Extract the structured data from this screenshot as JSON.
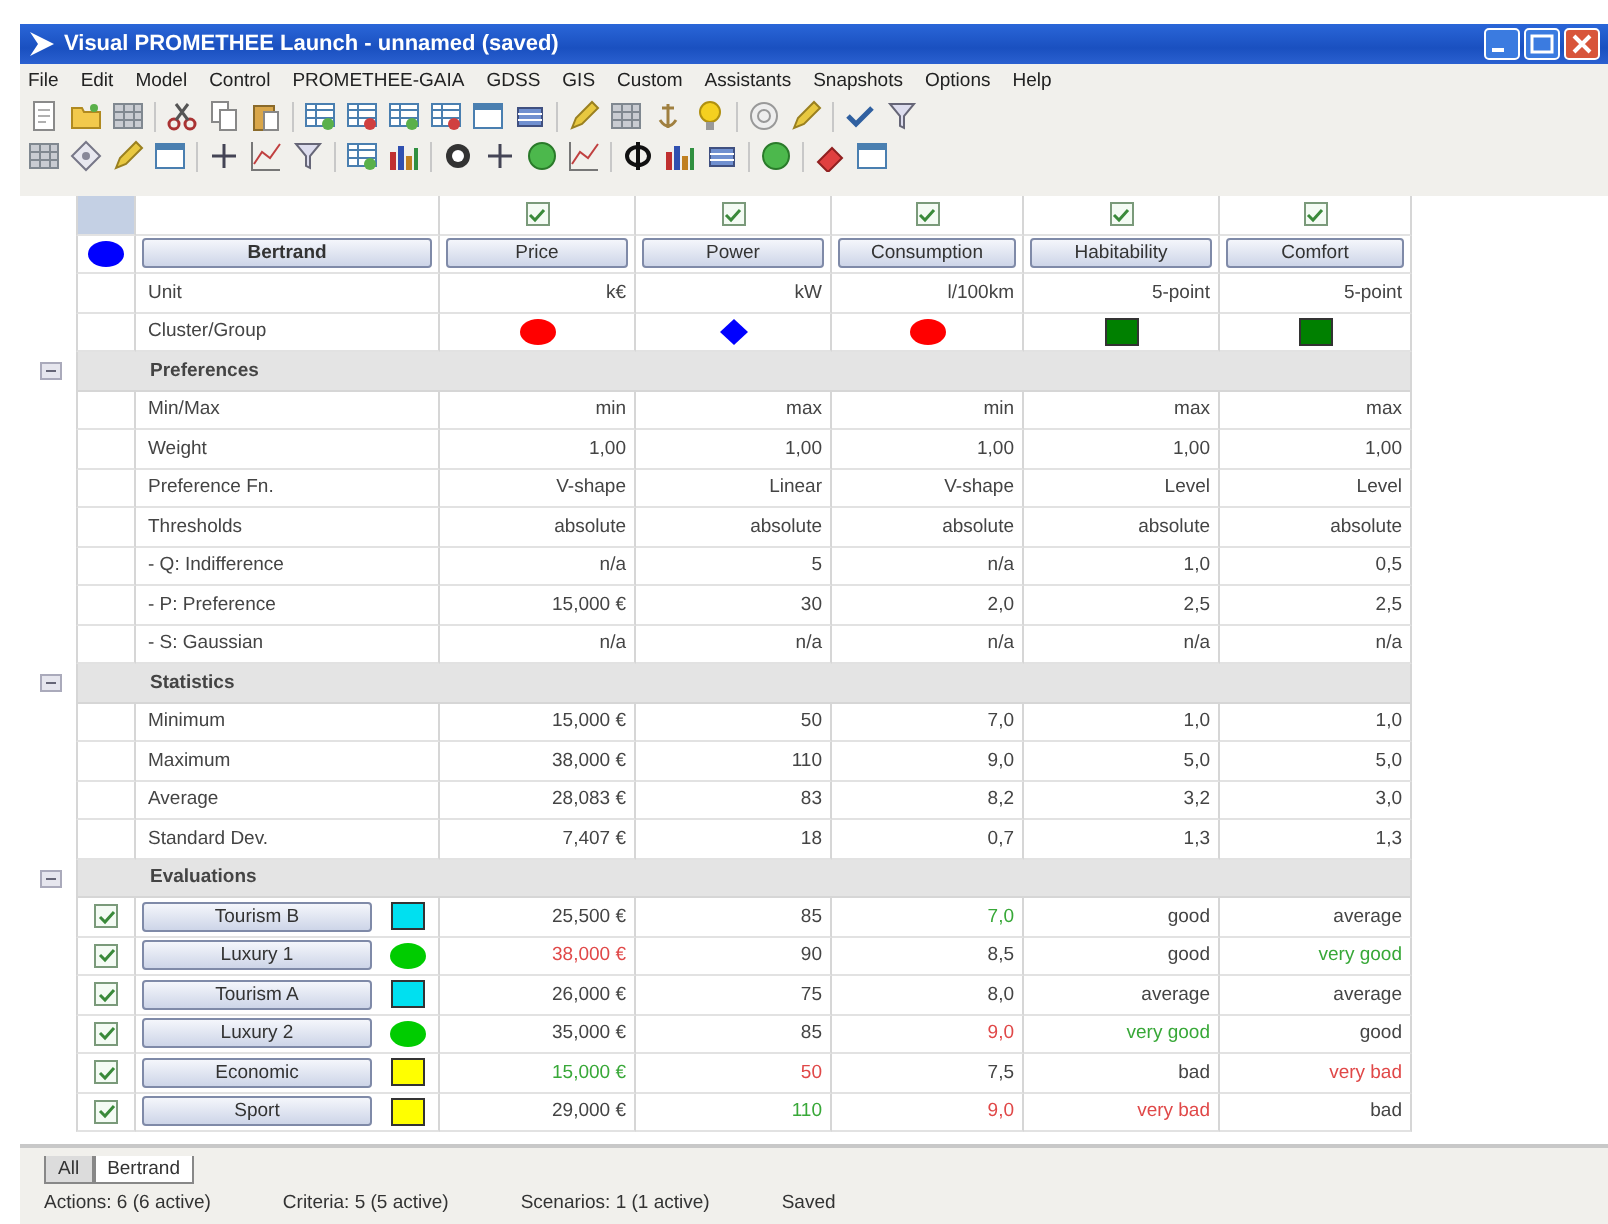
{
  "window": {
    "title": "Visual PROMETHEE Launch - unnamed (saved)"
  },
  "menu": [
    "File",
    "Edit",
    "Model",
    "Control",
    "PROMETHEE-GAIA",
    "GDSS",
    "GIS",
    "Custom",
    "Assistants",
    "Snapshots",
    "Options",
    "Help"
  ],
  "scenario": {
    "name": "Bertrand",
    "marker": {
      "kind": "ellipse",
      "color": "#0000ff"
    }
  },
  "row_labels": {
    "unit": "Unit",
    "cluster": "Cluster/Group"
  },
  "criteria": [
    {
      "name": "Price",
      "checked": true,
      "unit": "k€",
      "cluster": {
        "kind": "ellipse",
        "color": "#ff0000"
      }
    },
    {
      "name": "Power",
      "checked": true,
      "unit": "kW",
      "cluster": {
        "kind": "diamond",
        "color": "#0000ff"
      }
    },
    {
      "name": "Consumption",
      "checked": true,
      "unit": "l/100km",
      "cluster": {
        "kind": "ellipse",
        "color": "#ff0000"
      }
    },
    {
      "name": "Habitability",
      "checked": true,
      "unit": "5-point",
      "cluster": {
        "kind": "square",
        "color": "#008000"
      }
    },
    {
      "name": "Comfort",
      "checked": true,
      "unit": "5-point",
      "cluster": {
        "kind": "square",
        "color": "#008000"
      }
    }
  ],
  "preferences": {
    "title": "Preferences",
    "expanded": true,
    "rows": [
      {
        "label": "Min/Max",
        "values": [
          "min",
          "max",
          "min",
          "max",
          "max"
        ]
      },
      {
        "label": "Weight",
        "values": [
          "1,00",
          "1,00",
          "1,00",
          "1,00",
          "1,00"
        ]
      },
      {
        "label": "Preference Fn.",
        "values": [
          "V-shape",
          "Linear",
          "V-shape",
          "Level",
          "Level"
        ]
      },
      {
        "label": "Thresholds",
        "values": [
          "absolute",
          "absolute",
          "absolute",
          "absolute",
          "absolute"
        ]
      },
      {
        "label": "- Q: Indifference",
        "values": [
          "n/a",
          "5",
          "n/a",
          "1,0",
          "0,5"
        ]
      },
      {
        "label": "- P: Preference",
        "values": [
          "15,000 €",
          "30",
          "2,0",
          "2,5",
          "2,5"
        ]
      },
      {
        "label": "- S: Gaussian",
        "values": [
          "n/a",
          "n/a",
          "n/a",
          "n/a",
          "n/a"
        ]
      }
    ]
  },
  "statistics": {
    "title": "Statistics",
    "expanded": true,
    "rows": [
      {
        "label": "Minimum",
        "values": [
          "15,000 €",
          "50",
          "7,0",
          "1,0",
          "1,0"
        ]
      },
      {
        "label": "Maximum",
        "values": [
          "38,000 €",
          "110",
          "9,0",
          "5,0",
          "5,0"
        ]
      },
      {
        "label": "Average",
        "values": [
          "28,083 €",
          "83",
          "8,2",
          "3,2",
          "3,0"
        ]
      },
      {
        "label": "Standard Dev.",
        "values": [
          "7,407 €",
          "18",
          "0,7",
          "1,3",
          "1,3"
        ]
      }
    ]
  },
  "evaluations": {
    "title": "Evaluations",
    "expanded": true,
    "actions": [
      {
        "name": "Tourism B",
        "checked": true,
        "marker": {
          "kind": "square",
          "color": "#00e0f0"
        },
        "values": [
          {
            "text": "25,500 €"
          },
          {
            "text": "85"
          },
          {
            "text": "7,0",
            "color": "#38a838"
          },
          {
            "text": "good"
          },
          {
            "text": "average"
          }
        ]
      },
      {
        "name": "Luxury 1",
        "checked": true,
        "marker": {
          "kind": "ellipse",
          "color": "#00cc00"
        },
        "values": [
          {
            "text": "38,000 €",
            "color": "#e04848"
          },
          {
            "text": "90"
          },
          {
            "text": "8,5"
          },
          {
            "text": "good"
          },
          {
            "text": "very good",
            "color": "#38a838"
          }
        ]
      },
      {
        "name": "Tourism A",
        "checked": true,
        "marker": {
          "kind": "square",
          "color": "#00e0f0"
        },
        "values": [
          {
            "text": "26,000 €"
          },
          {
            "text": "75"
          },
          {
            "text": "8,0"
          },
          {
            "text": "average"
          },
          {
            "text": "average"
          }
        ]
      },
      {
        "name": "Luxury 2",
        "checked": true,
        "marker": {
          "kind": "ellipse",
          "color": "#00cc00"
        },
        "values": [
          {
            "text": "35,000 €"
          },
          {
            "text": "85"
          },
          {
            "text": "9,0",
            "color": "#e04848"
          },
          {
            "text": "very good",
            "color": "#38a838"
          },
          {
            "text": "good"
          }
        ]
      },
      {
        "name": "Economic",
        "checked": true,
        "marker": {
          "kind": "square",
          "color": "#ffff00"
        },
        "values": [
          {
            "text": "15,000 €",
            "color": "#38a838"
          },
          {
            "text": "50",
            "color": "#e04848"
          },
          {
            "text": "7,5"
          },
          {
            "text": "bad"
          },
          {
            "text": "very bad",
            "color": "#e04848"
          }
        ]
      },
      {
        "name": "Sport",
        "checked": true,
        "marker": {
          "kind": "square",
          "color": "#ffff00"
        },
        "values": [
          {
            "text": "29,000 €"
          },
          {
            "text": "110",
            "color": "#38a838"
          },
          {
            "text": "9,0",
            "color": "#e04848"
          },
          {
            "text": "very bad",
            "color": "#e04848"
          },
          {
            "text": "bad"
          }
        ]
      }
    ]
  },
  "tabs": [
    {
      "label": "All",
      "selected": false
    },
    {
      "label": "Bertrand",
      "selected": true
    }
  ],
  "status_bar": [
    "Actions: 6 (6 active)",
    "Criteria: 5 (5 active)",
    "Scenarios: 1 (1 active)",
    "Saved"
  ]
}
